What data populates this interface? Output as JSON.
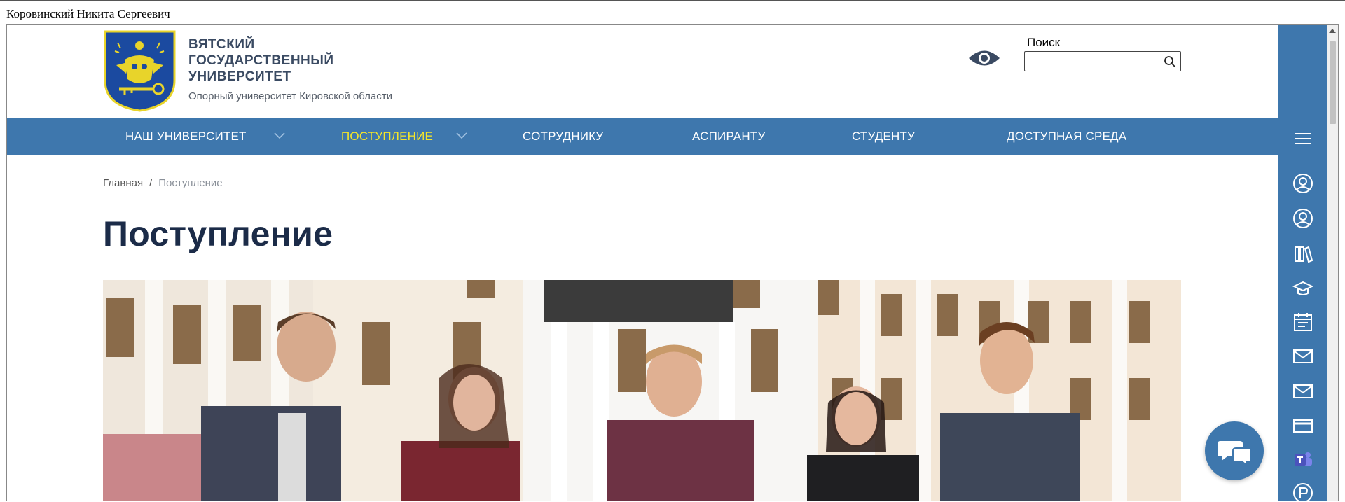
{
  "window": {
    "title": "Коровинский Никита Сергеевич"
  },
  "header": {
    "name_lines": [
      "ВЯТСКИЙ",
      "ГОСУДАРСТВЕННЫЙ",
      "УНИВЕРСИТЕТ"
    ],
    "subtitle": "Опорный университет Кировской области",
    "search_label": "Поиск",
    "search_value": "",
    "search_placeholder": ""
  },
  "nav": {
    "items": [
      {
        "label": "НАШ УНИВЕРСИТЕТ",
        "dropdown": true,
        "active": false
      },
      {
        "label": "ПОСТУПЛЕНИЕ",
        "dropdown": true,
        "active": true
      },
      {
        "label": "СОТРУДНИКУ",
        "dropdown": false,
        "active": false
      },
      {
        "label": "АСПИРАНТУ",
        "dropdown": false,
        "active": false
      },
      {
        "label": "СТУДЕНТУ",
        "dropdown": false,
        "active": false
      },
      {
        "label": "ДОСТУПНАЯ СРЕДА",
        "dropdown": false,
        "active": false
      }
    ]
  },
  "breadcrumb": {
    "home": "Главная",
    "separator": "/",
    "current": "Поступление"
  },
  "page": {
    "title": "Поступление"
  },
  "right_panel": {
    "icons": [
      "menu-icon",
      "user-circle-icon",
      "user-circle-icon",
      "library-icon",
      "graduation-cap-icon",
      "calendar-icon",
      "mail-icon",
      "mail-icon",
      "card-icon",
      "teams-icon",
      "circle-r-icon"
    ]
  },
  "colors": {
    "primary_blue": "#3e77ad",
    "active_yellow": "#f5e629",
    "title_navy": "#1b2b48"
  }
}
